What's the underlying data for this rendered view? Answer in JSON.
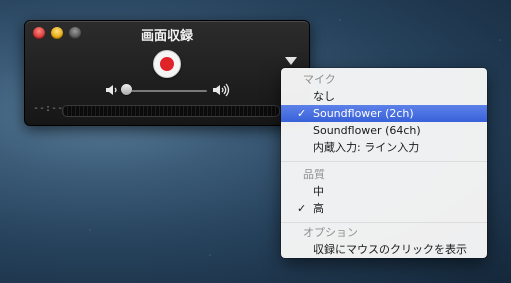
{
  "window": {
    "title": "画面収録",
    "time_display": "--:--"
  },
  "menu": {
    "mic_header": "マイク",
    "mic_items": [
      {
        "label": "なし",
        "checked": false
      },
      {
        "label": "Soundflower (2ch)",
        "checked": true
      },
      {
        "label": "Soundflower (64ch)",
        "checked": false
      },
      {
        "label": "内蔵入力: ライン入力",
        "checked": false
      }
    ],
    "quality_header": "品質",
    "quality_items": [
      {
        "label": "中",
        "checked": false
      },
      {
        "label": "高",
        "checked": true
      }
    ],
    "options_header": "オプション",
    "option_items": [
      {
        "label": "収録にマウスのクリックを表示",
        "checked": false
      }
    ],
    "checkmark": "✓"
  },
  "icons": {
    "close": "close-icon",
    "minimize": "minimize-icon",
    "zoom": "zoom-icon",
    "record": "record-icon",
    "options": "triangle-down-icon",
    "volume_low": "speaker-low-icon",
    "volume_high": "speaker-high-icon"
  },
  "colors": {
    "record_red": "#e0232a",
    "menu_highlight": "#3962d9",
    "close_red": "#d32f2f",
    "minimize_yellow": "#e0a300"
  }
}
